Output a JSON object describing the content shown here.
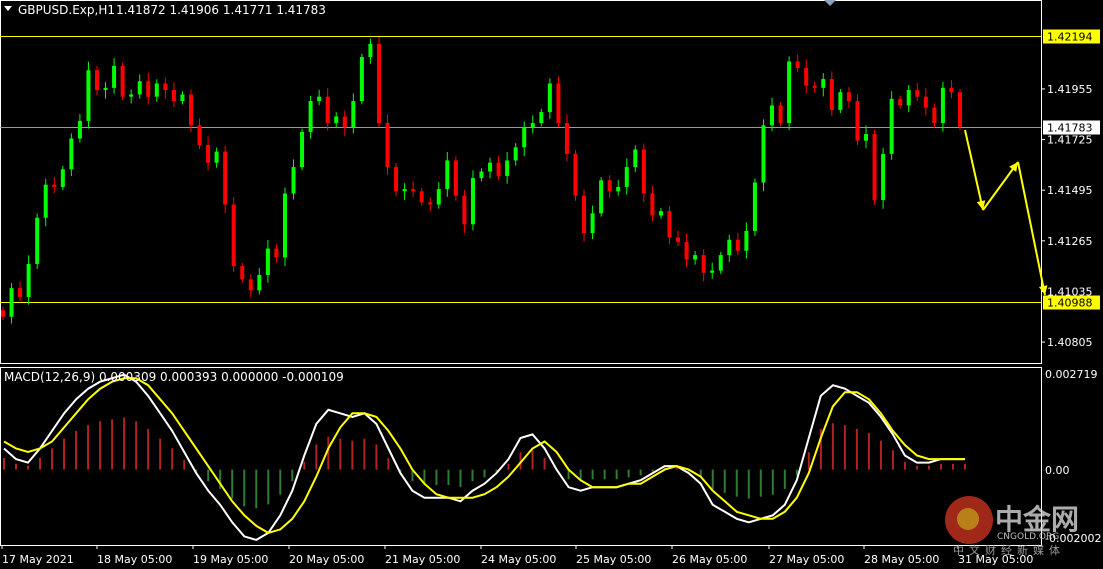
{
  "header": {
    "symbol": "GBPUSD.Exp,H1",
    "ohlc": "1.41872 1.41906 1.41771 1.41783"
  },
  "colors": {
    "background": "#000000",
    "bull": "#00ff00",
    "bear": "#ff0000",
    "level_line": "#ffff00",
    "arrow": "#ffff00",
    "macd_line": "#ffffff",
    "signal_line": "#ffff00",
    "hist_up": "#b22222",
    "hist_down": "#2e7d32",
    "axis_text": "#ffffff"
  },
  "chart_data": [
    {
      "type": "candlestick",
      "symbol": "GBPUSD.Exp",
      "timeframe": "H1",
      "y_ticks": [
        "1.41955",
        "1.41725",
        "1.41495",
        "1.41265",
        "1.41035",
        "1.40805"
      ],
      "ylim": [
        1.4071,
        1.4235
      ],
      "levels": [
        {
          "label": "1.42194",
          "value": 1.42194,
          "style": "yellow"
        },
        {
          "label": "1.41783",
          "value": 1.41783,
          "style": "current"
        },
        {
          "label": "1.40988",
          "value": 1.40988,
          "style": "yellow"
        }
      ],
      "x_labels": [
        "17 May 2021",
        "18 May 05:00",
        "19 May 05:00",
        "20 May 05:00",
        "21 May 05:00",
        "24 May 05:00",
        "25 May 05:00",
        "26 May 05:00",
        "27 May 05:00",
        "28 May 05:00",
        "31 May 05:00"
      ],
      "closes": [
        1.4092,
        1.4105,
        1.4101,
        1.4116,
        1.4137,
        1.4152,
        1.4151,
        1.4159,
        1.4173,
        1.4181,
        1.4204,
        1.4195,
        1.4196,
        1.4206,
        1.4192,
        1.4193,
        1.4199,
        1.4192,
        1.4198,
        1.4195,
        1.419,
        1.4193,
        1.4179,
        1.417,
        1.4162,
        1.4167,
        1.4143,
        1.4115,
        1.4109,
        1.4104,
        1.4111,
        1.4123,
        1.4119,
        1.4148,
        1.416,
        1.4176,
        1.419,
        1.4192,
        1.418,
        1.4183,
        1.4178,
        1.419,
        1.421,
        1.4216,
        1.418,
        1.416,
        1.4149,
        1.415,
        1.4149,
        1.4144,
        1.4143,
        1.415,
        1.4163,
        1.4147,
        1.4134,
        1.4155,
        1.4158,
        1.4162,
        1.4156,
        1.4163,
        1.4169,
        1.4178,
        1.418,
        1.4185,
        1.4198,
        1.418,
        1.4166,
        1.4147,
        1.413,
        1.4139,
        1.4154,
        1.4149,
        1.4151,
        1.416,
        1.4168,
        1.4148,
        1.4138,
        1.414,
        1.4128,
        1.4126,
        1.4118,
        1.412,
        1.4112,
        1.4113,
        1.412,
        1.4127,
        1.4122,
        1.4131,
        1.4153,
        1.4179,
        1.4188,
        1.418,
        1.4208,
        1.4205,
        1.4197,
        1.4196,
        1.42,
        1.4186,
        1.4194,
        1.419,
        1.4172,
        1.4175,
        1.4145,
        1.4166,
        1.4191,
        1.4188,
        1.4195,
        1.4192,
        1.4187,
        1.418,
        1.4196,
        1.4194,
        1.41783
      ],
      "candle_count": 111
    },
    {
      "type": "macd",
      "label": "MACD(12,26,9) 0.000309 0.000393 0.000000 -0.000109",
      "params": "12,26,9",
      "y_ticks": [
        "0.002719",
        "0.00",
        "-0.002002"
      ],
      "ylim": [
        -0.002002,
        0.002719
      ],
      "zero": 0.0,
      "macd": [
        0.0006,
        0.0003,
        0.0002,
        0.0006,
        0.0011,
        0.0016,
        0.002,
        0.0023,
        0.0025,
        0.0026,
        0.0027,
        0.0025,
        0.0021,
        0.0016,
        0.0011,
        0.0005,
        -0.0001,
        -0.0006,
        -0.001,
        -0.0015,
        -0.0019,
        -0.002,
        -0.0018,
        -0.0013,
        -0.0006,
        0.0004,
        0.0013,
        0.0017,
        0.0016,
        0.0015,
        0.0016,
        0.0013,
        0.0006,
        -0.0001,
        -0.0006,
        -0.0008,
        -0.0008,
        -0.0008,
        -0.0009,
        -0.0006,
        -0.0004,
        -0.0001,
        0.0003,
        0.0009,
        0.001,
        0.0006,
        0.0,
        -0.0005,
        -0.0006,
        -0.0005,
        -0.0005,
        -0.0005,
        -0.0004,
        -0.0003,
        -0.0001,
        0.0001,
        0.0001,
        -0.0001,
        -0.0004,
        -0.001,
        -0.0012,
        -0.0014,
        -0.0015,
        -0.0014,
        -0.0013,
        -0.001,
        -0.0003,
        0.0009,
        0.0021,
        0.0024,
        0.0023,
        0.0021,
        0.0019,
        0.0015,
        0.001,
        0.0004,
        0.0002,
        0.0002,
        0.0003,
        0.0003,
        0.0003
      ],
      "signal": [
        0.0008,
        0.0006,
        0.0005,
        0.0006,
        0.0008,
        0.0012,
        0.0016,
        0.002,
        0.0023,
        0.0025,
        0.0026,
        0.0026,
        0.0024,
        0.002,
        0.0016,
        0.0011,
        0.0006,
        0.0001,
        -0.0004,
        -0.0009,
        -0.0013,
        -0.0016,
        -0.0018,
        -0.0017,
        -0.0014,
        -0.0009,
        -0.0002,
        0.0006,
        0.0012,
        0.0016,
        0.0016,
        0.0015,
        0.0011,
        0.0006,
        0.0,
        -0.0004,
        -0.0007,
        -0.0008,
        -0.0008,
        -0.0008,
        -0.0007,
        -0.0005,
        -0.0002,
        0.0002,
        0.0006,
        0.0008,
        0.0005,
        0.0,
        -0.0003,
        -0.0005,
        -0.0005,
        -0.0005,
        -0.0004,
        -0.0004,
        -0.0002,
        0.0,
        0.0001,
        0.0,
        -0.0002,
        -0.0006,
        -0.0009,
        -0.0012,
        -0.0013,
        -0.0014,
        -0.0014,
        -0.0012,
        -0.0008,
        -0.0001,
        0.0009,
        0.0018,
        0.0022,
        0.0022,
        0.002,
        0.0016,
        0.0011,
        0.0007,
        0.0004,
        0.0003,
        0.0003,
        0.0003,
        0.0003
      ]
    }
  ]
}
